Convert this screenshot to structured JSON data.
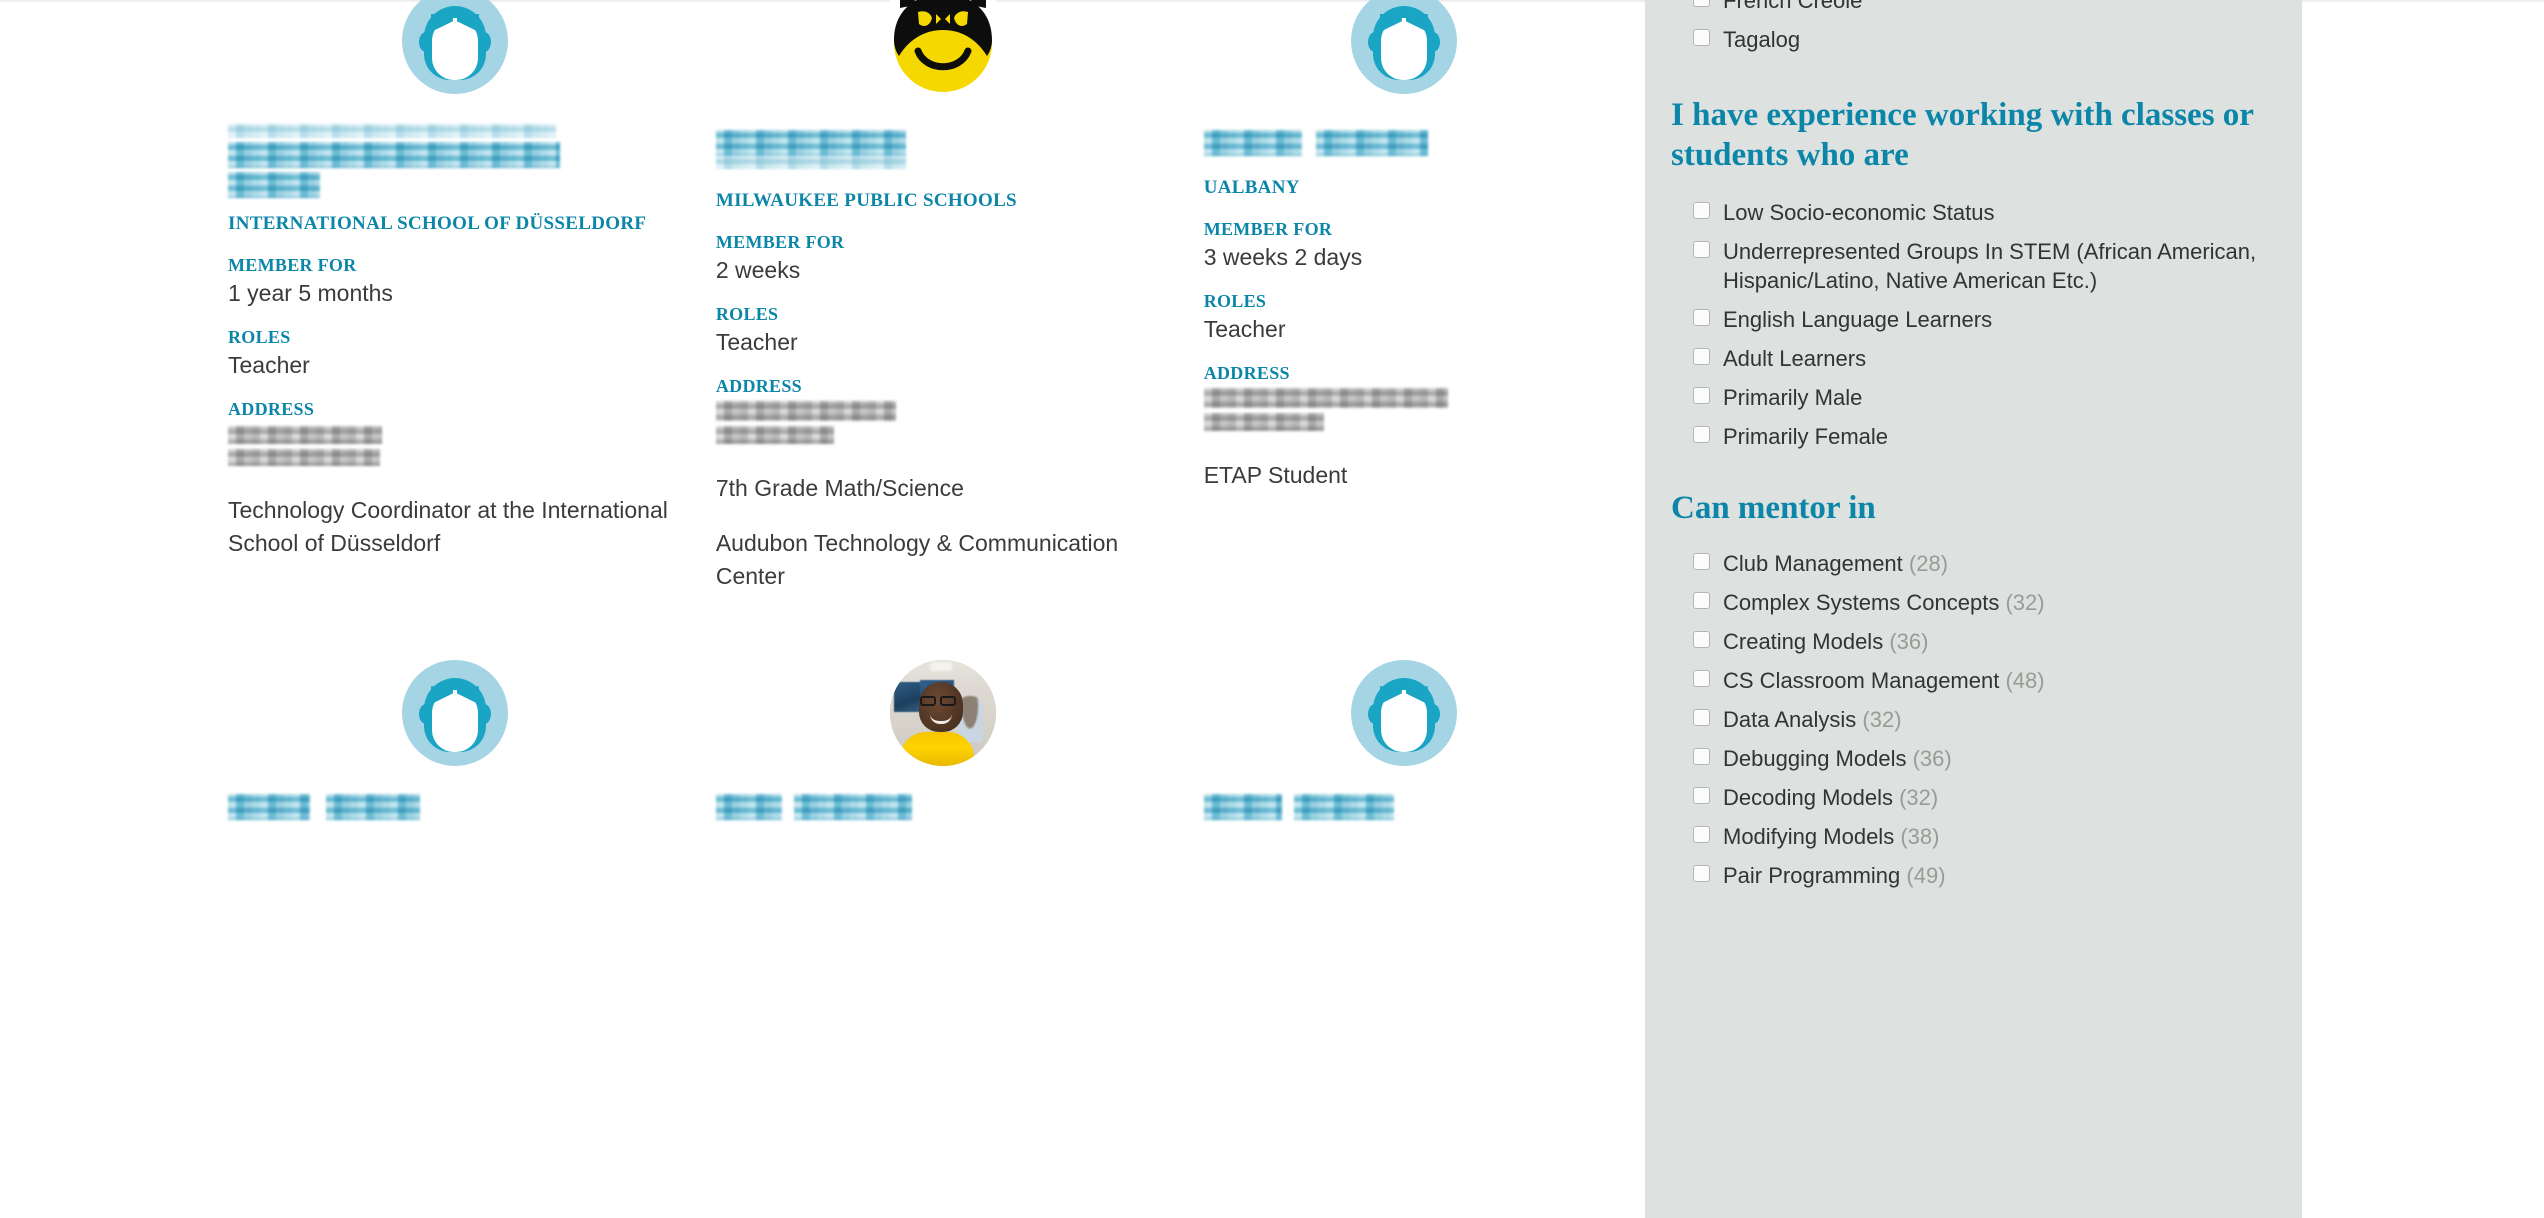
{
  "colors": {
    "accent_teal": "#0c86a8",
    "avatar_ring": "#a5d5e4",
    "avatar_fill": "#1ba5c4",
    "sidebar_bg": "#dde1e0",
    "body_text": "#3b3b3b",
    "count_text": "#9b9b95",
    "smiley_yellow": "#f5d800",
    "smiley_mask": "#0d0d0d"
  },
  "results": {
    "rows": [
      {
        "cards": [
          {
            "avatar": {
              "type": "default-avatar-icon",
              "alt": "default user avatar"
            },
            "name_redacted": true,
            "org": "INTERNATIONAL SCHOOL OF DÜSSELDORF",
            "fields": [
              {
                "label": "MEMBER FOR",
                "value": "1 year 5 months"
              },
              {
                "label": "ROLES",
                "value": "Teacher"
              },
              {
                "label": "ADDRESS",
                "value": "",
                "redacted": true
              }
            ],
            "bio": "Technology Coordinator at the International School of Düsseldorf"
          },
          {
            "avatar": {
              "type": "smiley-mask-avatar-icon",
              "alt": "yellow smiley face with black mask"
            },
            "name_redacted": true,
            "org": "MILWAUKEE PUBLIC SCHOOLS",
            "fields": [
              {
                "label": "MEMBER FOR",
                "value": "2 weeks"
              },
              {
                "label": "ROLES",
                "value": "Teacher"
              },
              {
                "label": "ADDRESS",
                "value": "",
                "redacted": true
              }
            ],
            "bio": "7th Grade Math/Science",
            "bio2": "Audubon Technology & Communication Center"
          },
          {
            "avatar": {
              "type": "default-avatar-icon",
              "alt": "default user avatar"
            },
            "name_redacted": true,
            "org": "UALBANY",
            "fields": [
              {
                "label": "MEMBER FOR",
                "value": "3 weeks 2 days"
              },
              {
                "label": "ROLES",
                "value": "Teacher"
              },
              {
                "label": "ADDRESS",
                "value": "",
                "redacted": true
              }
            ],
            "bio": "ETAP Student"
          }
        ]
      },
      {
        "cards": [
          {
            "avatar": {
              "type": "default-avatar-icon",
              "alt": "default user avatar"
            },
            "name_redacted": true
          },
          {
            "avatar": {
              "type": "photo-avatar",
              "alt": "photo of person in yellow shirt in a classroom"
            },
            "name_redacted": true
          },
          {
            "avatar": {
              "type": "default-avatar-icon",
              "alt": "default user avatar"
            },
            "name_redacted": true
          }
        ]
      }
    ]
  },
  "facets": {
    "languages_tail": [
      {
        "label": "French Creole",
        "count": null
      },
      {
        "label": "Tagalog",
        "count": null
      }
    ],
    "experience": {
      "heading": "I have experience working with classes or students who are",
      "items": [
        {
          "label": "Low Socio-economic Status",
          "count": null
        },
        {
          "label": "Underrepresented Groups In STEM (African American, Hispanic/Latino, Native American Etc.)",
          "count": null
        },
        {
          "label": "English Language Learners",
          "count": null
        },
        {
          "label": "Adult Learners",
          "count": null
        },
        {
          "label": "Primarily Male",
          "count": null
        },
        {
          "label": "Primarily Female",
          "count": null
        }
      ]
    },
    "mentor": {
      "heading": "Can mentor in",
      "items": [
        {
          "label": "Club Management",
          "count": "(28)"
        },
        {
          "label": "Complex Systems Concepts",
          "count": "(32)"
        },
        {
          "label": "Creating Models",
          "count": "(36)"
        },
        {
          "label": "CS Classroom Management",
          "count": "(48)"
        },
        {
          "label": "Data Analysis",
          "count": "(32)"
        },
        {
          "label": "Debugging Models",
          "count": "(36)"
        },
        {
          "label": "Decoding Models",
          "count": "(32)"
        },
        {
          "label": "Modifying Models",
          "count": "(38)"
        },
        {
          "label": "Pair Programming",
          "count": "(49)"
        }
      ]
    }
  }
}
